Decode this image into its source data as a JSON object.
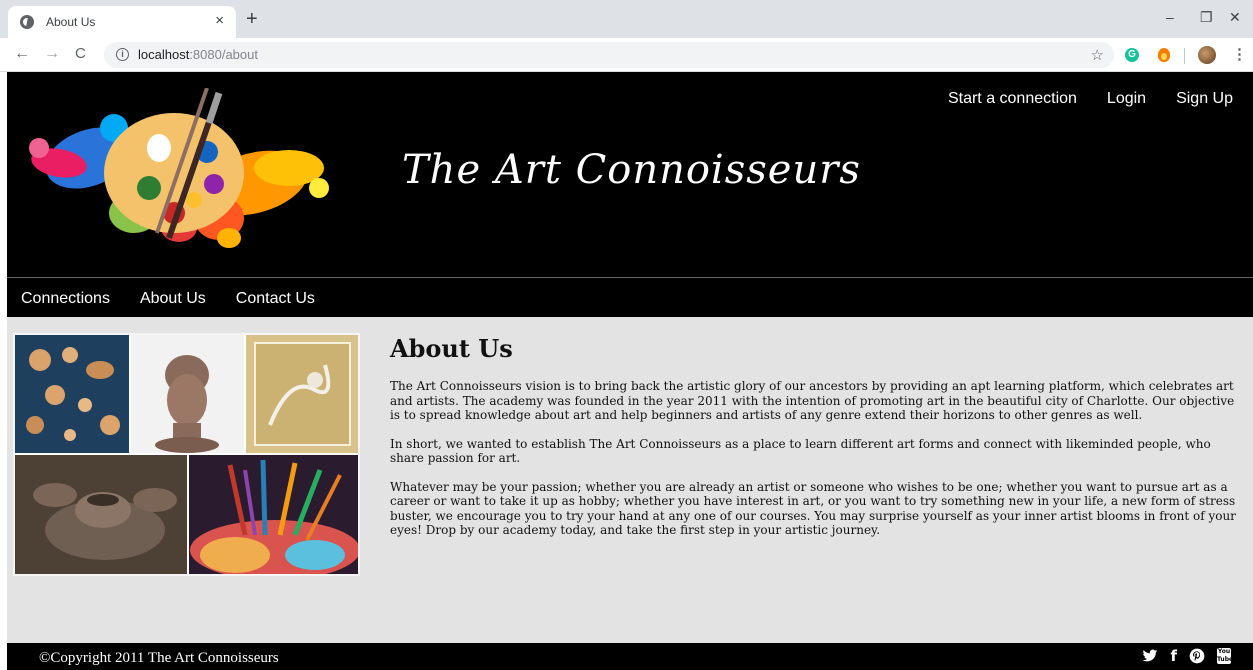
{
  "browser": {
    "tab_title": "About Us",
    "tab_close": "×",
    "new_tab": "+",
    "url_host": "localhost",
    "url_path": ":8080/about",
    "window_controls": {
      "minimize": "–",
      "maximize": "❐",
      "close": "✕"
    },
    "extensions": {
      "grammarly": "G"
    }
  },
  "header": {
    "site_title": "The Art Connoisseurs",
    "top_links": [
      "Start a connection",
      "Login",
      "Sign Up"
    ]
  },
  "navbar": {
    "items": [
      "Connections",
      "About Us",
      "Contact Us"
    ]
  },
  "content": {
    "heading": "About Us",
    "paragraphs": [
      "The Art Connoisseurs vision is to bring back the artistic glory of our ancestors by providing an apt learning platform, which celebrates art and artists. The academy was founded in the year 2011 with the intention of promoting art in the beautiful city of Charlotte. Our objective is to spread knowledge about art and help beginners and artists of any genre extend their horizons to other genres as well.",
      "In short, we wanted to establish The Art Connoisseurs as a place to learn different art forms and connect with likeminded people, who share passion for art.",
      "Whatever may be your passion; whether you are already an artist or someone who wishes to be one; whether you want to pursue art as a career or want to take it up as hobby; whether you have interest in art, or you want to try something new in your life, a new form of stress buster, we encourage you to try your hand at any one of our courses. You may surprise yourself as your inner artist blooms in front of your eyes! Drop by our academy today, and take the first step in your artistic journey."
    ]
  },
  "footer": {
    "copyright": "©Copyright 2011 The Art Connoisseurs",
    "social": {
      "twitter": "🐦",
      "facebook": "f",
      "pinterest": "℗",
      "youtube": "You Tube"
    }
  },
  "colors": {
    "header_bg": "#000000",
    "page_bg": "#e3e3e3",
    "text": "#111111"
  }
}
